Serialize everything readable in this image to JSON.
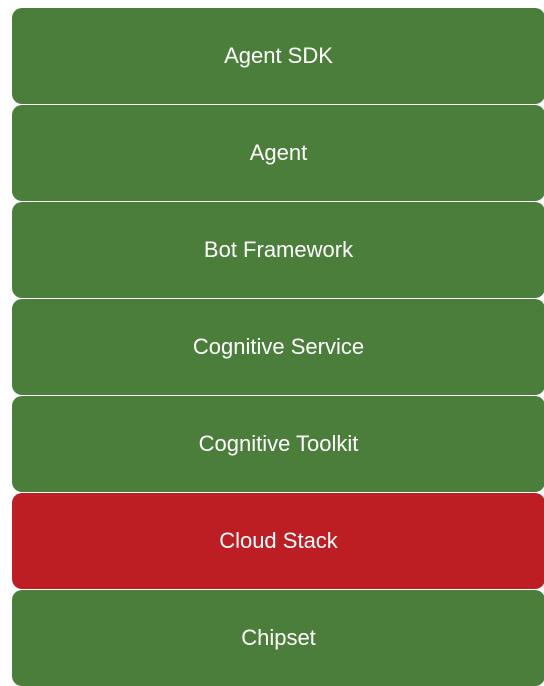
{
  "diagram": {
    "layers": [
      {
        "label": "Agent SDK",
        "color": "#4b7e3b",
        "highlighted": false
      },
      {
        "label": "Agent",
        "color": "#4b7e3b",
        "highlighted": false
      },
      {
        "label": "Bot Framework",
        "color": "#4b7e3b",
        "highlighted": false
      },
      {
        "label": "Cognitive Service",
        "color": "#4b7e3b",
        "highlighted": false
      },
      {
        "label": "Cognitive Toolkit",
        "color": "#4b7e3b",
        "highlighted": false
      },
      {
        "label": "Cloud Stack",
        "color": "#bd1e24",
        "highlighted": true
      },
      {
        "label": "Chipset",
        "color": "#4b7e3b",
        "highlighted": false
      }
    ]
  }
}
